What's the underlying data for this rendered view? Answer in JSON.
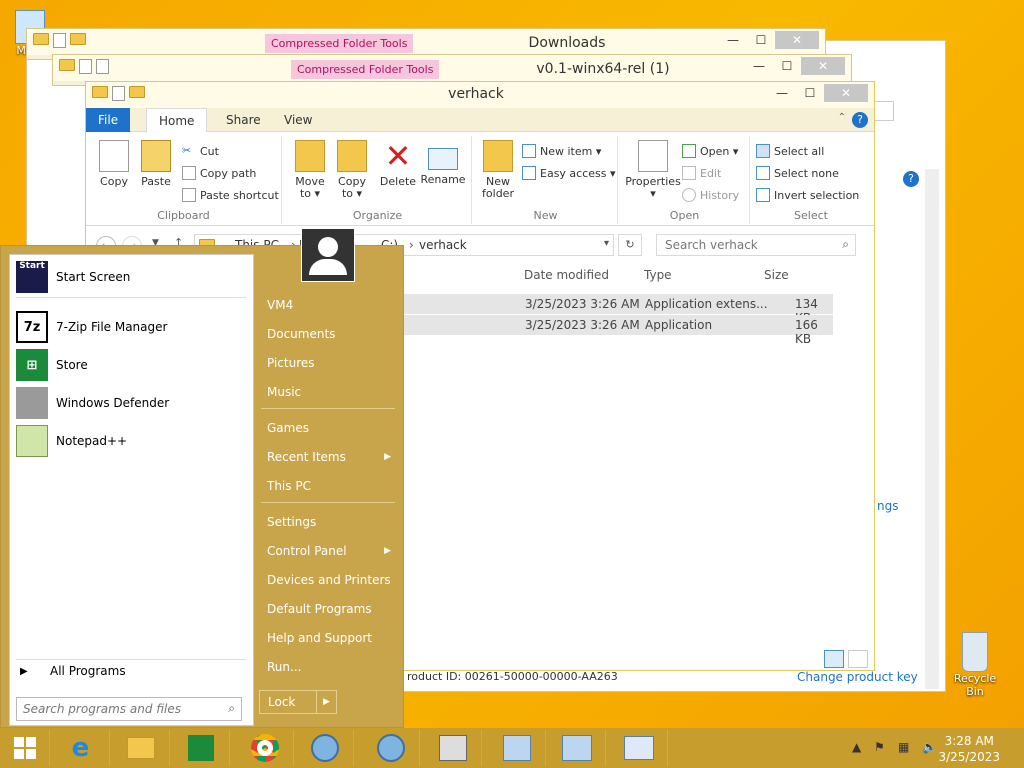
{
  "desktop": {
    "mycomputer_label": "My C",
    "recycle_label": "Recycle Bin",
    "behind_link": "ngs",
    "behind_product_id": "roduct ID: 00261-50000-00000-AA263",
    "behind_change_key": "Change product key"
  },
  "windows": {
    "downloads": {
      "title": "Downloads",
      "tools": "Compressed Folder Tools"
    },
    "v01": {
      "title": "v0.1-winx64-rel (1)",
      "tools": "Compressed Folder Tools"
    },
    "verhack": {
      "title": "verhack"
    }
  },
  "ribbon": {
    "tabs": [
      "File",
      "Home",
      "Share",
      "View"
    ],
    "clipboard": {
      "label": "Clipboard",
      "copy": "Copy",
      "paste": "Paste",
      "cut": "Cut",
      "copy_path": "Copy path",
      "paste_shortcut": "Paste shortcut"
    },
    "organize": {
      "label": "Organize",
      "move_to": "Move",
      "move_to2": "to ▾",
      "copy_to": "Copy",
      "copy_to2": "to ▾",
      "delete": "Delete",
      "rename": "Rename"
    },
    "new": {
      "label": "New",
      "new_folder": "New",
      "new_folder2": "folder",
      "new_item": "New item ▾",
      "easy_access": "Easy access ▾"
    },
    "open": {
      "label": "Open",
      "properties": "Properties",
      "open": "Open ▾",
      "edit": "Edit",
      "history": "History"
    },
    "select": {
      "label": "Select",
      "select_all": "Select all",
      "select_none": "Select none",
      "invert": "Invert selection"
    }
  },
  "address": {
    "crumb1": "This PC",
    "crumb2": "L",
    "crumb3": "C:)",
    "crumb4": "verhack",
    "search_placeholder": "Search verhack"
  },
  "columns": {
    "date": "Date modified",
    "type": "Type",
    "size": "Size"
  },
  "files": [
    {
      "date": "3/25/2023 3:26 AM",
      "type": "Application extens...",
      "size": "134 KB"
    },
    {
      "date": "3/25/2023 3:26 AM",
      "type": "Application",
      "size": "166 KB"
    }
  ],
  "start_menu": {
    "left": [
      {
        "label": "Start Screen",
        "icon": "Start"
      },
      {
        "label": "7-Zip File Manager",
        "icon": "7z"
      },
      {
        "label": "Store",
        "icon": "store"
      },
      {
        "label": "Windows Defender",
        "icon": "defender"
      },
      {
        "label": "Notepad++",
        "icon": "notepad"
      }
    ],
    "all_programs": "All Programs",
    "search_placeholder": "Search programs and files",
    "right": [
      "VM4",
      "Documents",
      "Pictures",
      "Music",
      "Games",
      "Recent Items",
      "This PC",
      "Settings",
      "Control Panel",
      "Devices and Printers",
      "Default Programs",
      "Help and Support",
      "Run..."
    ],
    "lock": "Lock"
  },
  "taskbar": {
    "time": "3:28 AM",
    "date": "3/25/2023"
  }
}
